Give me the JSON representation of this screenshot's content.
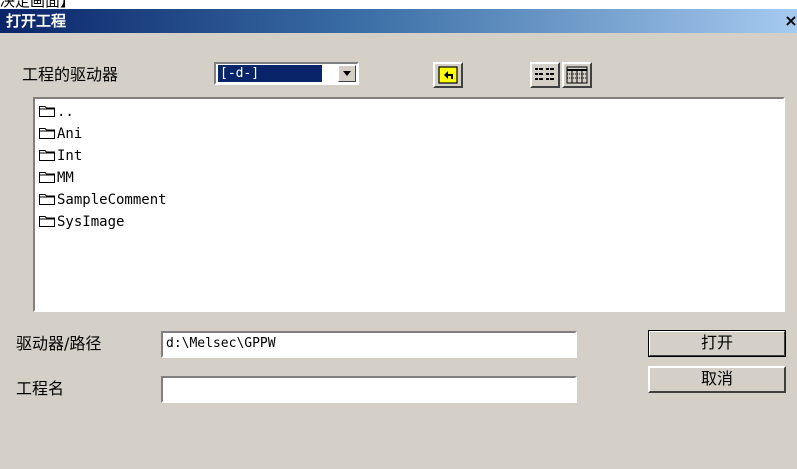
{
  "above_text": "决定画面】",
  "window": {
    "title": "打开工程",
    "close_glyph": "×"
  },
  "drive": {
    "label": "工程的驱动器",
    "selected": "[-d-]",
    "dropdown_icon": "chevron-down-icon"
  },
  "toolbar": {
    "up_folder_icon": "folder-up-icon",
    "list_view_icon": "list-view-icon",
    "detail_view_icon": "detail-view-icon"
  },
  "file_list": [
    {
      "name": ".."
    },
    {
      "name": "Ani"
    },
    {
      "name": "Int"
    },
    {
      "name": "MM"
    },
    {
      "name": "SampleComment"
    },
    {
      "name": "SysImage"
    }
  ],
  "path": {
    "label": "驱动器/路径",
    "value": "d:\\Melsec\\GPPW"
  },
  "project": {
    "label": "工程名",
    "value": ""
  },
  "buttons": {
    "open": "打开",
    "cancel": "取消"
  },
  "colors": {
    "face": "#d4d0c8",
    "title_start": "#0a246a",
    "title_end": "#a6caf0",
    "selection": "#0a246a",
    "folder_button_yellow": "#ffff00"
  }
}
